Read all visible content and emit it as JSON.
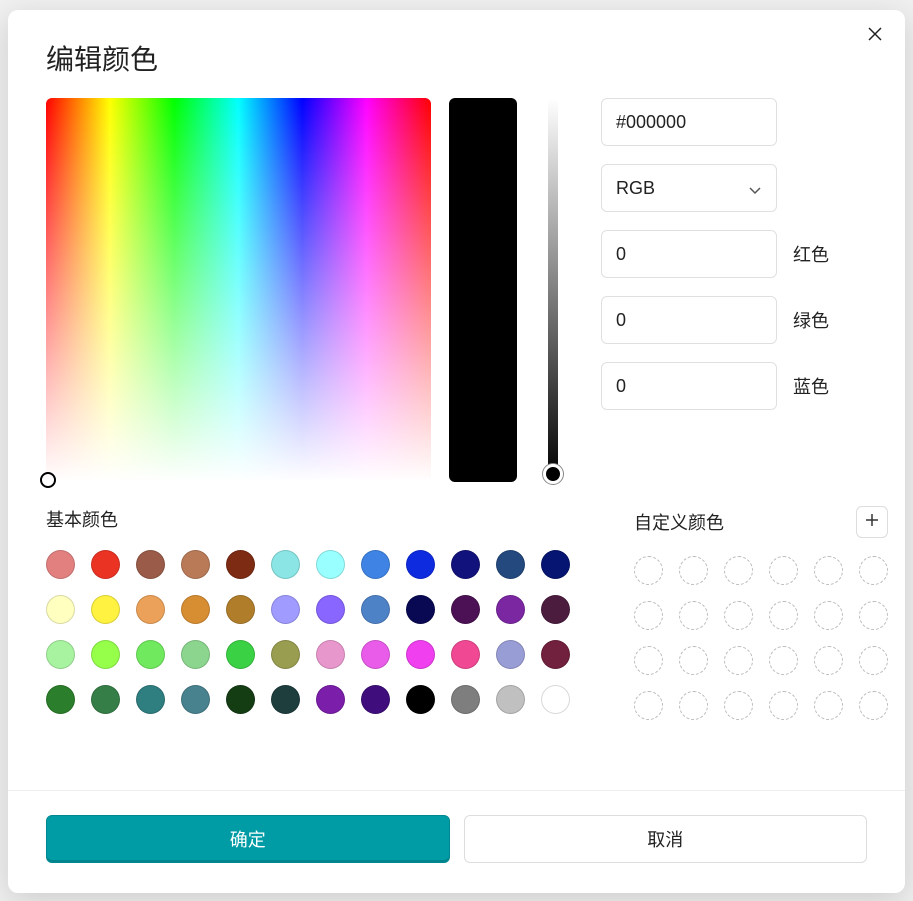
{
  "title": "编辑颜色",
  "hex_value": "#000000",
  "color_mode": "RGB",
  "channels": {
    "red": {
      "label": "红色",
      "value": "0"
    },
    "green": {
      "label": "绿色",
      "value": "0"
    },
    "blue": {
      "label": "蓝色",
      "value": "0"
    }
  },
  "preview_color": "#000000",
  "basic_colors_label": "基本颜色",
  "custom_colors_label": "自定义颜色",
  "basic_colors": [
    "#e28080",
    "#eb3324",
    "#9a5c48",
    "#b97a57",
    "#7e2b14",
    "#8be5e5",
    "#99ffff",
    "#3f84e4",
    "#0e2be0",
    "#12127c",
    "#23497f",
    "#051571",
    "#ffffbf",
    "#fff241",
    "#eba159",
    "#d78d32",
    "#b07e2b",
    "#9f9bff",
    "#8866ff",
    "#4e82c7",
    "#090953",
    "#4c1154",
    "#7c27a2",
    "#4c1c3f",
    "#a8f3a0",
    "#95ff4a",
    "#70e95e",
    "#8bd58e",
    "#3bd145",
    "#999d50",
    "#e897cc",
    "#e95ce9",
    "#ef3fef",
    "#f04893",
    "#999dd5",
    "#71203d",
    "#2b7e2b",
    "#357e47",
    "#2f7e80",
    "#48828f",
    "#153d14",
    "#1e3e3e",
    "#7b1eaa",
    "#3f0e7c",
    "#000000",
    "#7e7e7e",
    "#c0c0c0",
    "#ffffff"
  ],
  "custom_slot_count": 24,
  "buttons": {
    "ok": "确定",
    "cancel": "取消"
  }
}
